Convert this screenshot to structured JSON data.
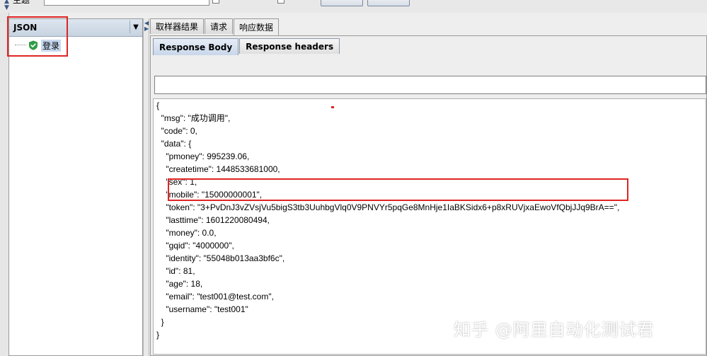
{
  "header": {
    "label": "主题"
  },
  "tree": {
    "renderer": "JSON",
    "items": [
      {
        "label": "登录",
        "status": "success"
      }
    ]
  },
  "outer_tabs": [
    {
      "label": "取样器结果",
      "active": false
    },
    {
      "label": "请求",
      "active": false
    },
    {
      "label": "响应数据",
      "active": true
    }
  ],
  "inner_tabs": [
    {
      "label": "Response Body",
      "active": true
    },
    {
      "label": "Response headers",
      "active": false
    }
  ],
  "search": {
    "value": ""
  },
  "response_lines": [
    "{",
    "  \"msg\": \"成功调用\",",
    "  \"code\": 0,",
    "  \"data\": {",
    "    \"pmoney\": 995239.06,",
    "    \"createtime\": 1448533681000,",
    "    \"sex\": 1,",
    "    \"mobile\": \"15000000001\",",
    "    \"token\": \"3+PvDnJ3vZVsjVu5bigS3tb3UuhbgVlq0V9PNVYr5pqGe8MnHje1IaBKSidx6+p8xRUVjxaEwoVfQbjJJq9BrA==\",",
    "    \"lasttime\": 1601220080494,",
    "    \"money\": 0.0,",
    "    \"gqid\": \"4000000\",",
    "    \"identity\": \"55048b013aa3bf6c\",",
    "    \"id\": 81,",
    "    \"age\": 18,",
    "    \"email\": \"test001@test.com\",",
    "    \"username\": \"test001\"",
    "  }",
    "}"
  ],
  "watermark": "知乎 @阿里自动化测试君",
  "colors": {
    "highlight_box": "#e02424",
    "tab_active": "#c8d7ea",
    "success": "#2ea043"
  }
}
